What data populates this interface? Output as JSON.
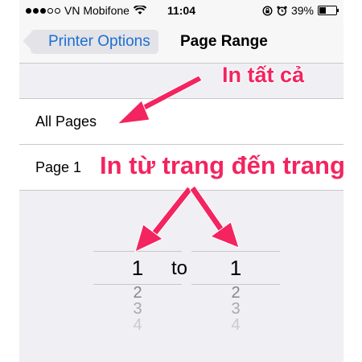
{
  "status_bar": {
    "carrier": "VN Mobifone",
    "time": "11:04",
    "battery": "39%",
    "battery_level": 0.39,
    "icons": [
      "signal-dots-icon",
      "wifi-icon",
      "rotation-lock-icon",
      "alarm-icon",
      "battery-icon"
    ]
  },
  "nav": {
    "back_label": "Printer Options",
    "title": "Page Range"
  },
  "options": [
    {
      "label": "All Pages"
    },
    {
      "label": "Page 1"
    }
  ],
  "picker": {
    "from": {
      "selected": "1",
      "below": [
        "2",
        "3",
        "4"
      ]
    },
    "separator": "to",
    "to": {
      "selected": "1",
      "below": [
        "2",
        "3",
        "4"
      ]
    }
  },
  "annotations": {
    "all_pages": "In tất cả",
    "page_range": "In từ trang đến trang",
    "color": "#f3245f"
  },
  "colors": {
    "ios_blue": "#1d6fd1",
    "background": "#efeff4"
  }
}
